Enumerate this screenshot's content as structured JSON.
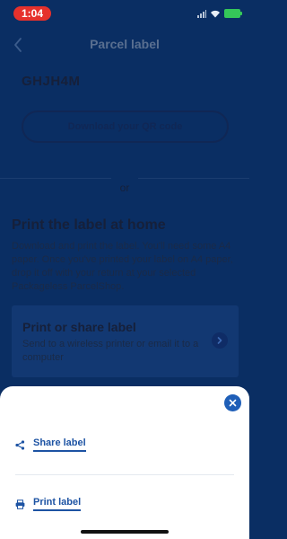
{
  "status_bar": {
    "time": "1:04"
  },
  "header": {
    "title": "Parcel label"
  },
  "content": {
    "code": "GHJH4M",
    "qr_button_label": "Download your QR code",
    "or_text": "or",
    "section_title": "Print the label at home",
    "section_body": "Download and print the label. You'll need some A4 paper. Once you've printed your label on A4 paper, drop it off with your return at your selected Packageless ParcelShop.",
    "print_card": {
      "title": "Print or share label",
      "description": "Send to a wireless printer or email it to a computer"
    }
  },
  "sheet": {
    "share_label": "Share label",
    "print_label": "Print label"
  },
  "icons": {
    "back": "chevron-left-icon",
    "close": "close-icon",
    "share": "share-icon",
    "print": "printer-icon",
    "chevron": "chevron-right-icon"
  },
  "colors": {
    "overlay_bg": "#0a2e63",
    "accent": "#1d53a3",
    "time_pill": "#e6312c",
    "battery": "#35c759"
  }
}
